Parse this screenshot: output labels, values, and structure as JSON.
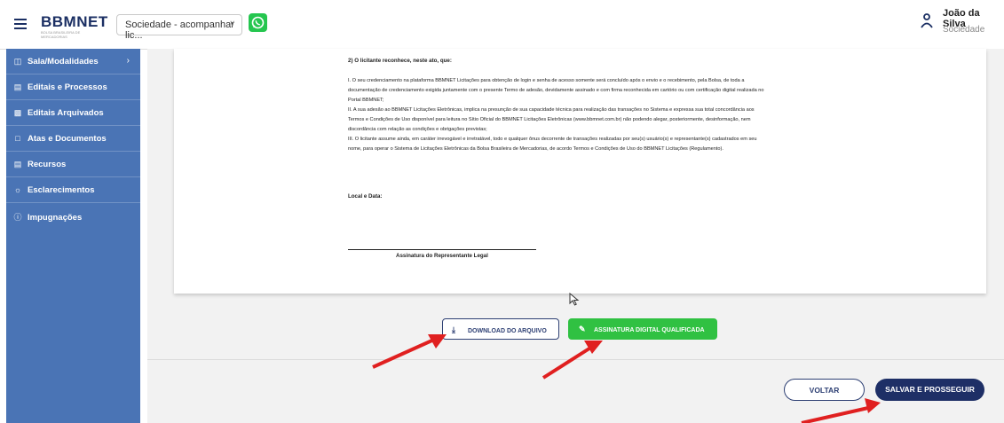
{
  "header": {
    "logo": "BBMNET",
    "logo_tagline": "BOLSA BRASILEIRA DE MERCADORIAS",
    "selector_value": "Sociedade - acompanhar lic...",
    "user_name": "João da Silva",
    "user_role": "Sociedade"
  },
  "sidebar": {
    "items": [
      {
        "label": "Sala/Modalidades",
        "icon": "rooms-icon"
      },
      {
        "label": "Editais e Processos",
        "icon": "cart-icon"
      },
      {
        "label": "Editais Arquivados",
        "icon": "archive-icon"
      },
      {
        "label": "Atas e Documentos",
        "icon": "document-icon"
      },
      {
        "label": "Recursos",
        "icon": "list-icon"
      },
      {
        "label": "Esclarecimentos",
        "icon": "lightbulb-icon"
      },
      {
        "label": "Impugnações",
        "icon": "info-icon"
      }
    ]
  },
  "document": {
    "heading": "2) O licitante reconhece, neste ato, que:",
    "paragraphs": [
      "I. O seu credenciamento na plataforma BBMNET Licitações para obtenção de login e senha de acesso somente será concluído após o envio e o recebimento, pela Bolsa, de toda a",
      "documentação de credenciamento exigida juntamente com o presente Termo de adesão, devidamente assinado e com firma reconhecida em cartório ou com certificação digital realizada no",
      "Portal BBMNET;",
      "II. A sua adesão ao BBMNET Licitações Eletrônicas, implica na presunção de sua capacidade técnica para realização das transações no Sistema e expressa sua total concordância aos",
      "Termos e Condições de Uso disponível para leitura no Sítio Oficial do BBMNET Licitações Eletrônicas (www.bbmnet.com.br) não podendo alegar, posteriormente, desinformação, nem",
      "discordância com relação as condições e obrigações previstas;",
      "III. O licitante assume ainda, em caráter irrevogável e irretratável, todo e qualquer ônus decorrente de transações realizadas por seu(s) usuário(s) e representante(s) cadastrados em seu",
      "nome, para operar o Sistema de Licitações Eletrônicas da Bolsa Brasileira de Mercadorias, de acordo Termos e Condições de Uso do BBMNET Licitações (Regulamento)."
    ],
    "local_data_label": "Local e Data:",
    "signature_label": "Assinatura do Representante Legal"
  },
  "actions": {
    "download_label": "DOWNLOAD DO ARQUIVO",
    "sign_label": "ASSINATURA DIGITAL QUALIFICADA",
    "back_label": "VOLTAR",
    "save_label": "SALVAR E PROSSEGUIR"
  },
  "colors": {
    "sidebar": "#4a74b5",
    "primary": "#1e2f66",
    "sign_green": "#30c142",
    "whatsapp": "#25c64f",
    "annotation_arrow": "#e02020"
  }
}
